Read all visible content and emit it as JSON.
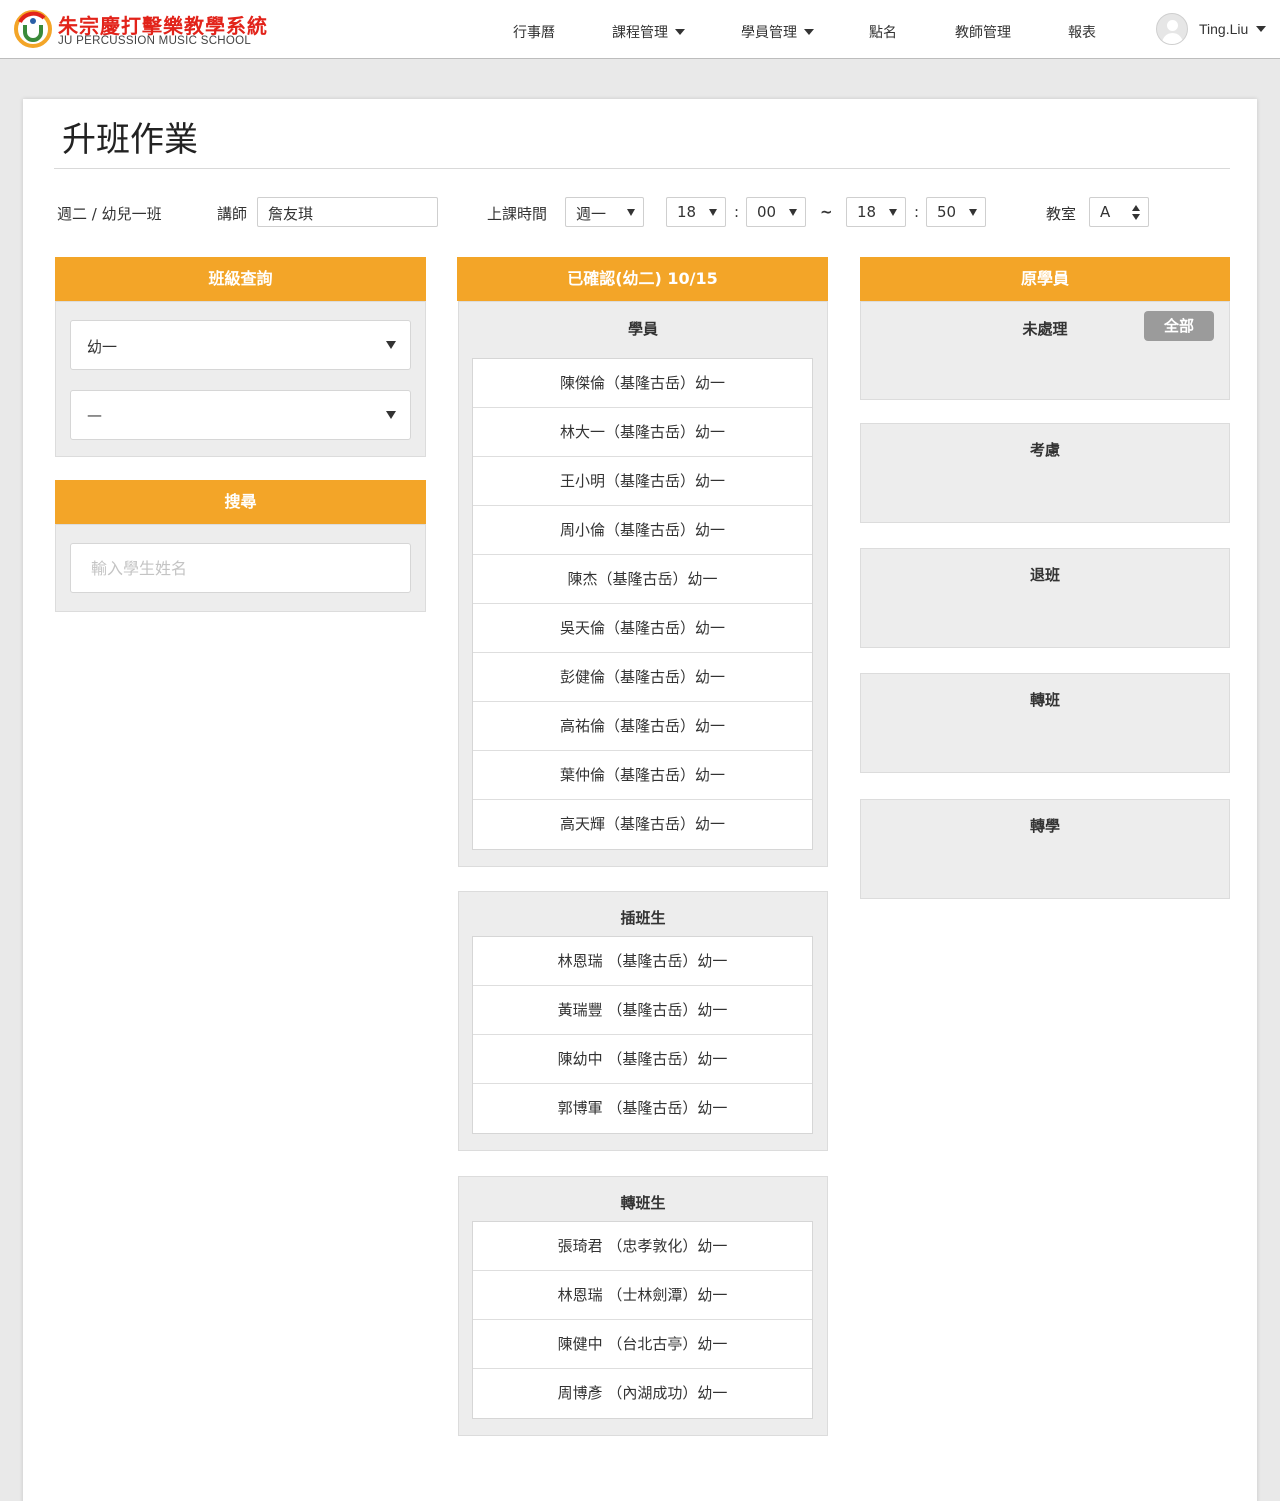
{
  "brand": {
    "name_cn": "朱宗慶打擊樂教學系統",
    "name_en": "JU PERCUSSION MUSIC SCHOOL",
    "accent": "#f3a528",
    "logo_red": "#e2231a"
  },
  "nav": {
    "items": [
      {
        "label": "行事曆",
        "has_dropdown": false
      },
      {
        "label": "課程管理",
        "has_dropdown": true
      },
      {
        "label": "學員管理",
        "has_dropdown": true
      },
      {
        "label": "點名",
        "has_dropdown": false
      },
      {
        "label": "教師管理",
        "has_dropdown": false
      },
      {
        "label": "報表",
        "has_dropdown": false
      }
    ],
    "user": {
      "name": "Ting.Liu",
      "icon": "user-avatar-icon"
    }
  },
  "page": {
    "title": "升班作業"
  },
  "filters": {
    "class_name": "週二 / 幼兒一班",
    "teacher_label": "講師",
    "teacher_value": "詹友琪",
    "time_label": "上課時間",
    "weekday": "週一",
    "start_hour": "18",
    "start_minute": "00",
    "time_separator": ":",
    "range_separator": "~",
    "end_hour": "18",
    "end_minute": "50",
    "room_label": "教室",
    "room_value": "A"
  },
  "class_query": {
    "header": "班級查詢",
    "select1": "幼一",
    "select2": "—"
  },
  "search": {
    "header": "搜尋",
    "placeholder": "輸入學生姓名"
  },
  "confirmed": {
    "header": "已確認(幼二) 10/15",
    "students_title": "學員",
    "students": [
      "陳傑倫（基隆古岳）幼一",
      "林大一（基隆古岳）幼一",
      "王小明（基隆古岳）幼一",
      "周小倫（基隆古岳）幼一",
      "陳杰（基隆古岳）幼一",
      "吳天倫（基隆古岳）幼一",
      "彭健倫（基隆古岳）幼一",
      "高祐倫（基隆古岳）幼一",
      "葉仲倫（基隆古岳）幼一",
      "高天輝（基隆古岳）幼一"
    ],
    "insert_title": "插班生",
    "insert_students": [
      "林恩瑞 （基隆古岳）幼一",
      "黃瑞豐 （基隆古岳）幼一",
      "陳幼中 （基隆古岳）幼一",
      "郭博軍 （基隆古岳）幼一"
    ],
    "transfer_title": "轉班生",
    "transfer_students": [
      "張琦君 （忠孝敦化）幼一",
      "林恩瑞 （士林劍潭）幼一",
      "陳健中 （台北古亭）幼一",
      "周博彥 （內湖成功）幼一"
    ]
  },
  "original": {
    "header": "原學員",
    "pending_title": "未處理",
    "all_button": "全部",
    "consider_title": "考慮",
    "withdraw_title": "退班",
    "change_class_title": "轉班",
    "change_school_title": "轉學"
  }
}
